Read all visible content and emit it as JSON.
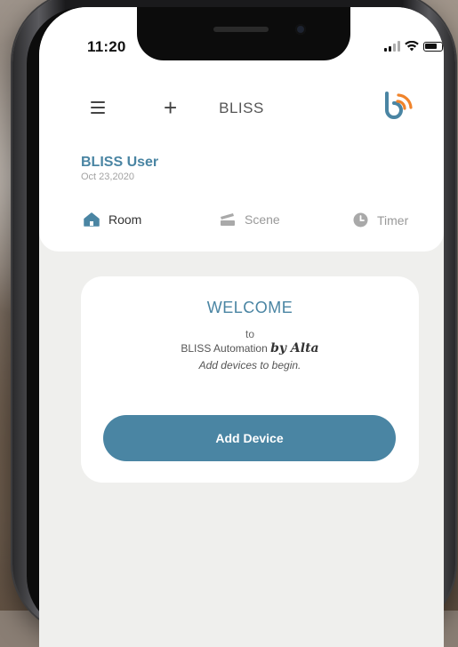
{
  "status_bar": {
    "time": "11:20"
  },
  "header": {
    "title": "BLISS",
    "menu_icon": "hamburger-menu-icon",
    "add_icon": "plus-icon",
    "logo_icon": "bliss-logo-icon",
    "plus_glyph": "+"
  },
  "user": {
    "name": "BLISS User",
    "date": "Oct 23,2020"
  },
  "tabs": [
    {
      "label": "Room",
      "icon": "home-icon",
      "active": true
    },
    {
      "label": "Scene",
      "icon": "scene-icon",
      "active": false
    },
    {
      "label": "Timer",
      "icon": "clock-icon",
      "active": false
    }
  ],
  "welcome": {
    "title": "WELCOME",
    "to": "to",
    "product": "BLISS Automation",
    "by": "by Alta",
    "subtitle": "Add devices to begin.",
    "button_label": "Add Device"
  },
  "colors": {
    "accent": "#4a85a3",
    "logo_blue": "#4a85a3",
    "logo_orange": "#f0832a",
    "background": "#efefed"
  }
}
